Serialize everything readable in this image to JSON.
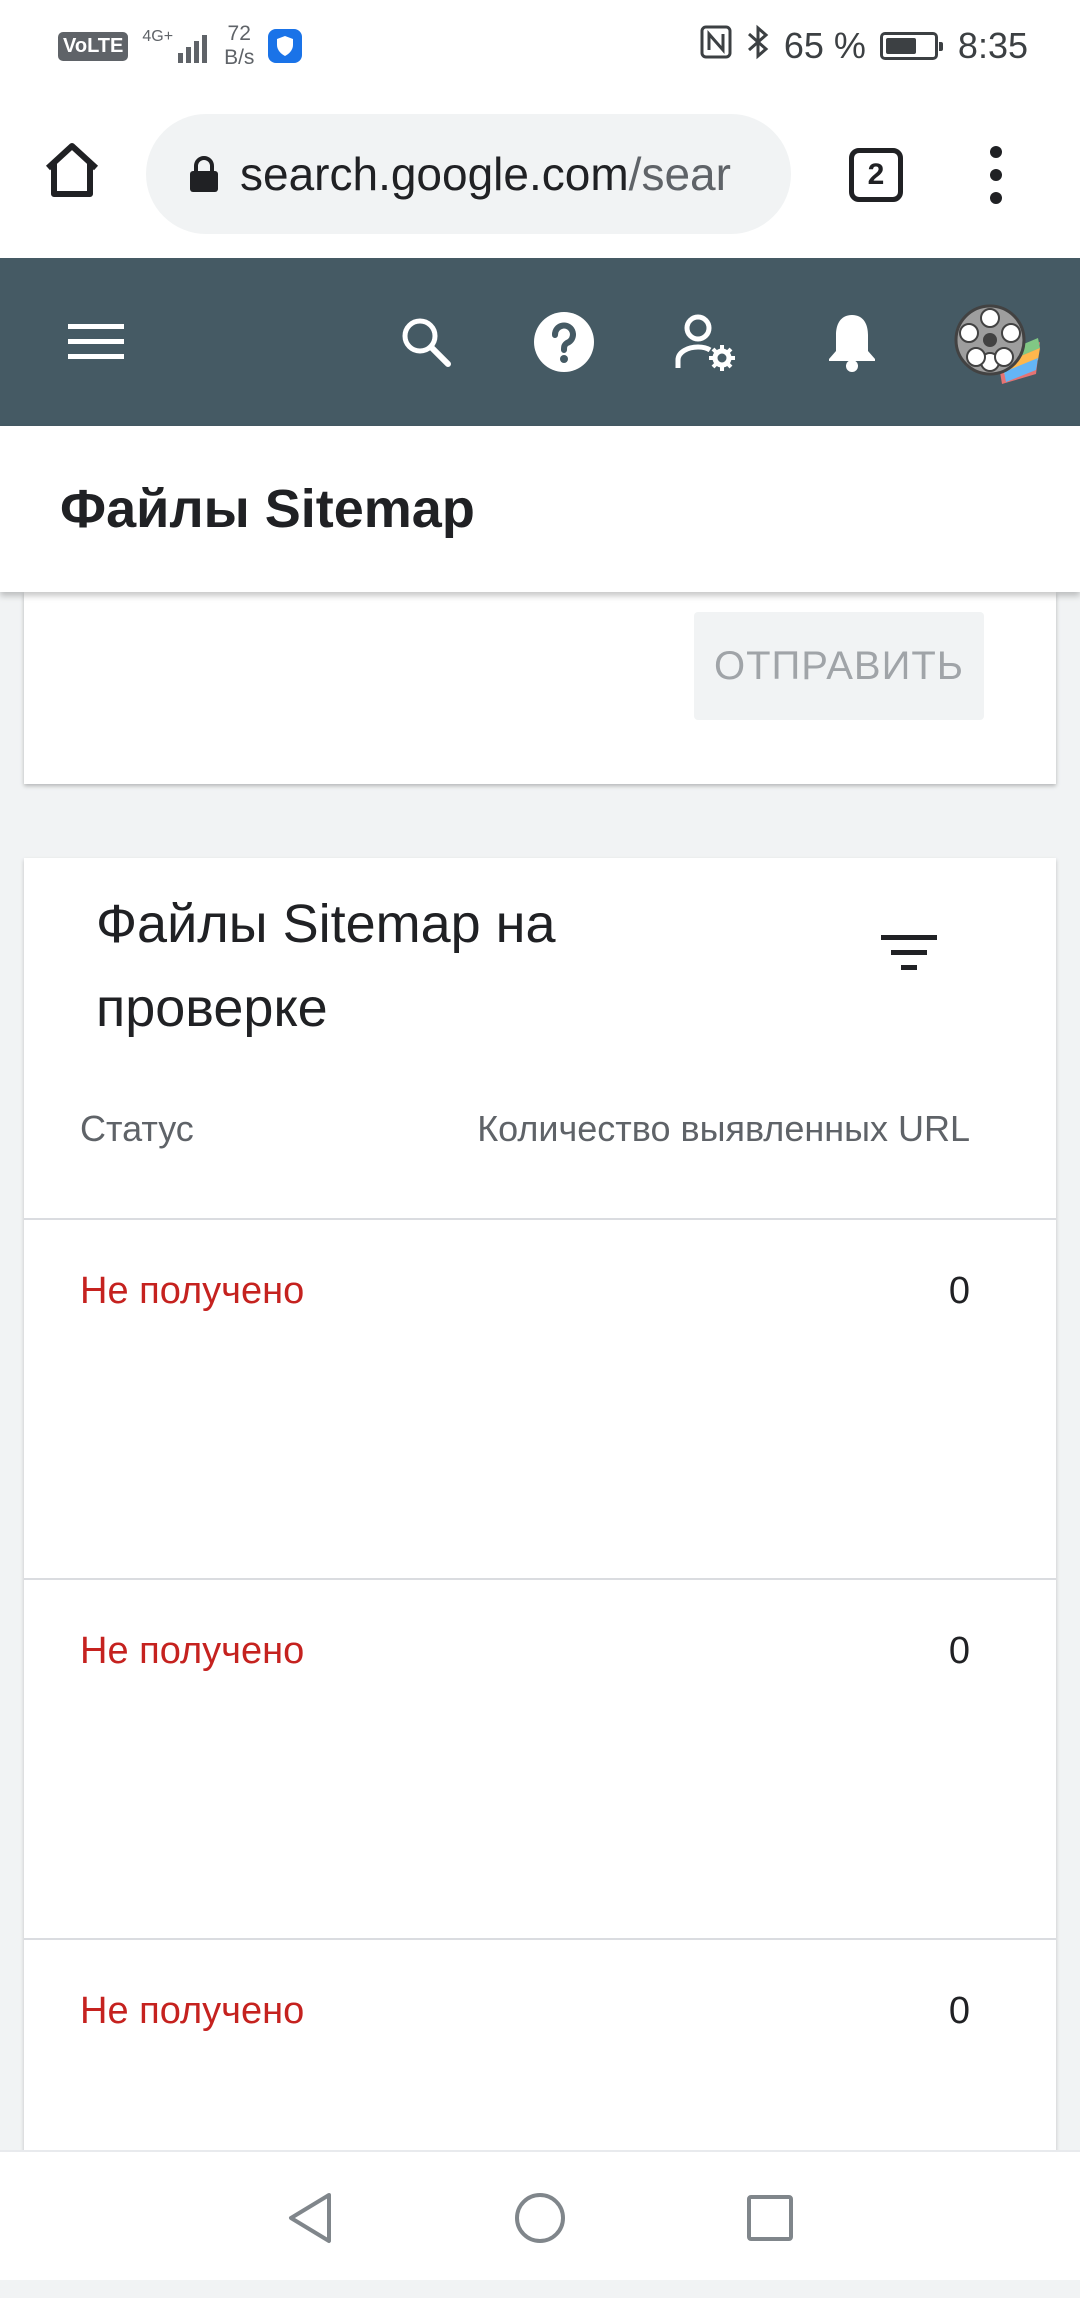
{
  "status_bar": {
    "volte": "VoLTE",
    "network": "4G+",
    "speed_value": "72",
    "speed_unit": "B/s",
    "battery_percent": "65 %",
    "battery_level": 0.65,
    "time": "8:35"
  },
  "browser": {
    "url_host": "search.google.com",
    "url_path": "/sear",
    "tab_count": "2"
  },
  "header": {
    "icons": [
      "menu-icon",
      "search-icon",
      "help-icon",
      "user-settings-icon",
      "notifications-icon",
      "avatar"
    ]
  },
  "page": {
    "title": "Файлы Sitemap"
  },
  "submit_card": {
    "submit_label": "ОТПРАВИТЬ"
  },
  "sitemaps": {
    "title": "Файлы Sitemap на проверке",
    "col_status": "Статус",
    "col_count": "Количество выявленных URL",
    "rows": [
      {
        "status": "Не получено",
        "count": "0"
      },
      {
        "status": "Не получено",
        "count": "0"
      },
      {
        "status": "Не получено",
        "count": "0"
      }
    ]
  },
  "colors": {
    "header_bg": "#455a64",
    "status_error": "#c5221f"
  }
}
